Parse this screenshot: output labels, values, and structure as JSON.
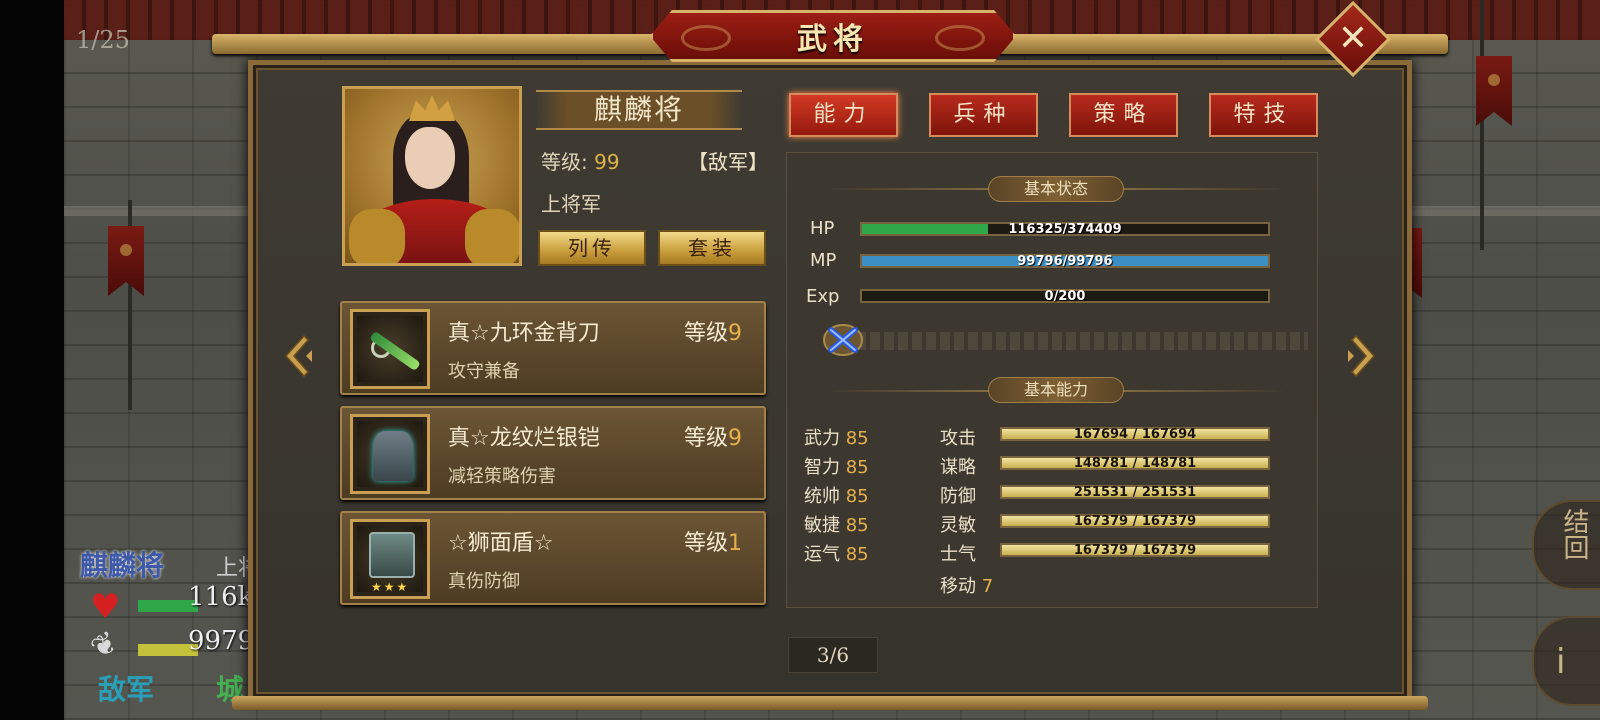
{
  "background": {
    "page_counter": "1/25",
    "unit": {
      "name": "麒麟将",
      "rank_partial": "上将",
      "hp_partial": "116k",
      "mp_partial": "9979",
      "faction": "敌军",
      "city_partial": "城"
    },
    "right_button_1": "结回",
    "right_button_2": "i"
  },
  "dialog": {
    "title": "武将",
    "close_icon": "close-icon"
  },
  "general": {
    "name": "麒麟将",
    "level_label": "等级:",
    "level_value": "99",
    "faction": "【敌军】",
    "rank": "上将军",
    "biography_button": "列传",
    "set_button": "套装"
  },
  "equipment": [
    {
      "name": "真☆九环金背刀",
      "level_label": "等级",
      "level": "9",
      "desc": "攻守兼备",
      "icon": "sword-icon"
    },
    {
      "name": "真☆龙纹烂银铠",
      "level_label": "等级",
      "level": "9",
      "desc": "减轻策略伤害",
      "icon": "armor-icon"
    },
    {
      "name": "☆狮面盾☆",
      "level_label": "等级",
      "level": "1",
      "desc": "真伤防御",
      "icon": "shield-icon",
      "stars": "★★★"
    }
  ],
  "tabs": [
    {
      "label": "能力",
      "active": true
    },
    {
      "label": "兵种",
      "active": false
    },
    {
      "label": "策略",
      "active": false
    },
    {
      "label": "特技",
      "active": false
    }
  ],
  "basic_status": {
    "title": "基本状态",
    "hp": {
      "label": "HP",
      "current": 116325,
      "max": 374409,
      "text": "116325/374409",
      "color": "#2fa84a"
    },
    "mp": {
      "label": "MP",
      "current": 99796,
      "max": 99796,
      "text": "99796/99796",
      "color": "#3c8fc4"
    },
    "exp": {
      "label": "Exp",
      "current": 0,
      "max": 200,
      "text": "0/200",
      "color": "#c9b050"
    }
  },
  "basic_ability": {
    "title": "基本能力",
    "attributes": [
      {
        "label": "武力",
        "value": "85"
      },
      {
        "label": "智力",
        "value": "85"
      },
      {
        "label": "统帅",
        "value": "85"
      },
      {
        "label": "敏捷",
        "value": "85"
      },
      {
        "label": "运气",
        "value": "85"
      }
    ],
    "combat": [
      {
        "label": "攻击",
        "text": "167694 / 167694",
        "current": 167694,
        "max": 167694
      },
      {
        "label": "谋略",
        "text": "148781 / 148781",
        "current": 148781,
        "max": 148781
      },
      {
        "label": "防御",
        "text": "251531 / 251531",
        "current": 251531,
        "max": 251531
      },
      {
        "label": "灵敏",
        "text": "167379 / 167379",
        "current": 167379,
        "max": 167379
      },
      {
        "label": "士气",
        "text": "167379 / 167379",
        "current": 167379,
        "max": 167379
      }
    ],
    "move_label": "移动",
    "move_value": "7"
  },
  "pagination": "3/6"
}
